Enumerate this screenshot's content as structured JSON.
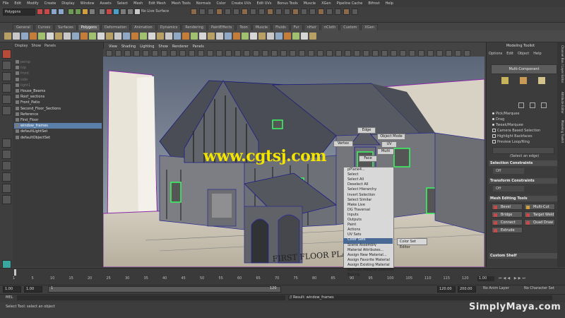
{
  "menubar": [
    "File",
    "Edit",
    "Modify",
    "Create",
    "Display",
    "Window",
    "Assets",
    "Select",
    "Mesh",
    "Edit Mesh",
    "Mesh Tools",
    "Normals",
    "Color",
    "Create UVs",
    "Edit UVs",
    "Bonus Tools",
    "Muscle",
    "XGen",
    "Pipeline Cache",
    "Bifrost",
    "Help"
  ],
  "status": {
    "mode": "Polygons",
    "surface_label": "No Live Surface"
  },
  "shelf_tabs": [
    "General",
    "Curves",
    "Surfaces",
    "Polygons",
    "Deformation",
    "Animation",
    "Dynamics",
    "Rendering",
    "PaintEffects",
    "Toon",
    "Muscle",
    "Fluids",
    "Fur",
    "nHair",
    "nCloth",
    "Custom",
    "XGen"
  ],
  "shelf_active": "Polygons",
  "outliner": {
    "menu": [
      "Display",
      "Show",
      "Panels"
    ],
    "items": [
      {
        "label": "persp",
        "dim": true
      },
      {
        "label": "top",
        "dim": true
      },
      {
        "label": "front",
        "dim": true
      },
      {
        "label": "side",
        "dim": true
      },
      {
        "label": "light1",
        "dim": true
      },
      {
        "label": "House_Beams",
        "dim": false
      },
      {
        "label": "Roof_sections",
        "dim": false
      },
      {
        "label": "Front_Patio",
        "dim": false
      },
      {
        "label": "Second_Floor_Sections",
        "dim": false
      },
      {
        "label": "Reference",
        "dim": false
      },
      {
        "label": "First_Floor",
        "dim": false
      },
      {
        "label": "window_frames",
        "dim": false,
        "selected": true
      },
      {
        "label": "defaultLightSet",
        "dim": false
      },
      {
        "label": "defaultObjectSet",
        "dim": false
      }
    ]
  },
  "viewport": {
    "menu": [
      "View",
      "Shading",
      "Lighting",
      "Show",
      "Renderer",
      "Panels"
    ],
    "radial": {
      "edge": "Edge",
      "object_mode": "Object Mode",
      "vertex": "Vertex",
      "uv": "UV",
      "multi": "Multi",
      "face": "Face"
    },
    "context_menu": [
      "pPlane4...",
      "Select",
      "Select All",
      "Deselect All",
      "Select Hierarchy",
      "Invert Selection",
      "Select Similar",
      "Make Live",
      "DG Traversal",
      "Inputs",
      "Outputs",
      "Paint",
      "Actions",
      "UV Sets",
      "Color Sets",
      "Scene Assembly",
      "Material Attributes...",
      "Assign New Material...",
      "Assign Favorite Material",
      "Assign Existing Material",
      "Remove Material Override",
      "Baking"
    ],
    "context_highlight": "Color Sets",
    "submenu": "Color Set Editor",
    "blueprint_text": "FIRST FLOOR PLAN"
  },
  "watermark": "www.cgtsj.com",
  "modeling_toolkit": {
    "title": "Modeling Toolkit",
    "menu": [
      "Options",
      "Edit",
      "Object",
      "Help"
    ],
    "multi_component": "Multi-Component",
    "options": [
      {
        "label": "Pick/Marquee",
        "kind": "radio"
      },
      {
        "label": "Drag",
        "kind": "radio"
      },
      {
        "label": "Tweak/Marquee",
        "kind": "radio"
      },
      {
        "label": "Camera Based Selection",
        "kind": "check"
      },
      {
        "label": "Highlight Backfaces",
        "kind": "check"
      },
      {
        "label": "Preview Loop/Ring",
        "kind": "check"
      }
    ],
    "select_hint": "(Select an edge)",
    "sections": {
      "selection_constraints": "Selection Constraints",
      "transform_constraints": "Transform Constraints",
      "mesh_editing": "Mesh Editing Tools",
      "custom_shelf": "Custom Shelf"
    },
    "off_label": "Off",
    "tools": [
      "Bevel",
      "Multi-Cut",
      "Bridge",
      "Target Weld",
      "Connect",
      "Quad Draw",
      "Extrude"
    ]
  },
  "side_tabs": [
    "Channel Box / Layer Editor",
    "Attribute Editor",
    "Modeling Toolkit"
  ],
  "timeline": {
    "ticks": [
      "1",
      "5",
      "10",
      "15",
      "20",
      "25",
      "30",
      "35",
      "40",
      "45",
      "50",
      "55",
      "60",
      "65",
      "70",
      "75",
      "80",
      "85",
      "90",
      "95",
      "100",
      "105",
      "110",
      "115",
      "120"
    ],
    "current": "1.00"
  },
  "range": {
    "start": "1.00",
    "start2": "1.00",
    "slider_start": "1",
    "slider_end": "120",
    "end": "120.00",
    "end2": "200.00",
    "anim_layer": "No Anim Layer",
    "char_set": "No Character Set"
  },
  "cmdline": {
    "lang": "MEL",
    "result": "// Result: window_frames"
  },
  "helpline": "Select Tool: select an object",
  "brand": "SimplyMaya.com"
}
